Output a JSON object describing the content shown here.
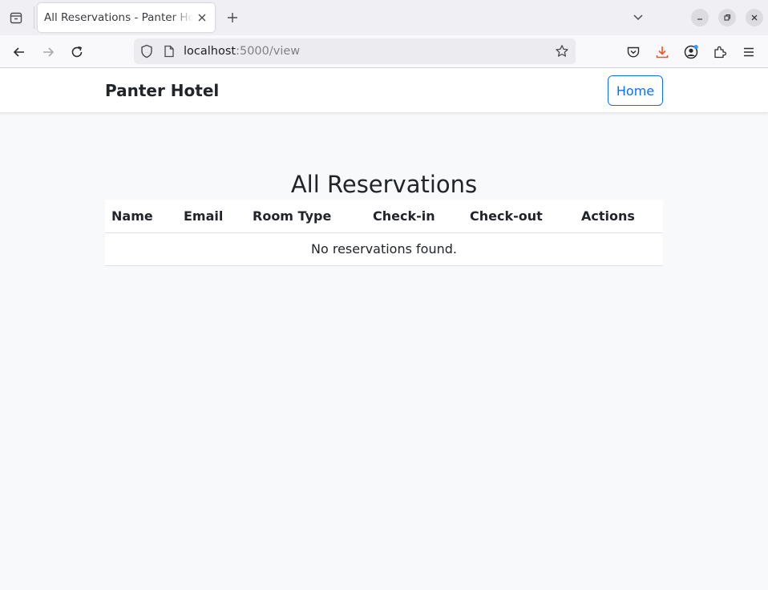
{
  "browser": {
    "tab_title": "All Reservations - Panter Hotel",
    "url_host": "localhost",
    "url_path": ":5000/view"
  },
  "site": {
    "brand": "Panter Hotel",
    "home_label": "Home"
  },
  "main": {
    "heading": "All Reservations",
    "table": {
      "columns": [
        "Name",
        "Email",
        "Room Type",
        "Check-in",
        "Check-out",
        "Actions"
      ],
      "empty_message": "No reservations found."
    }
  },
  "colors": {
    "primary": "#0d6efd",
    "page_bg": "#f8f9fa",
    "download_accent": "#e8562a"
  }
}
